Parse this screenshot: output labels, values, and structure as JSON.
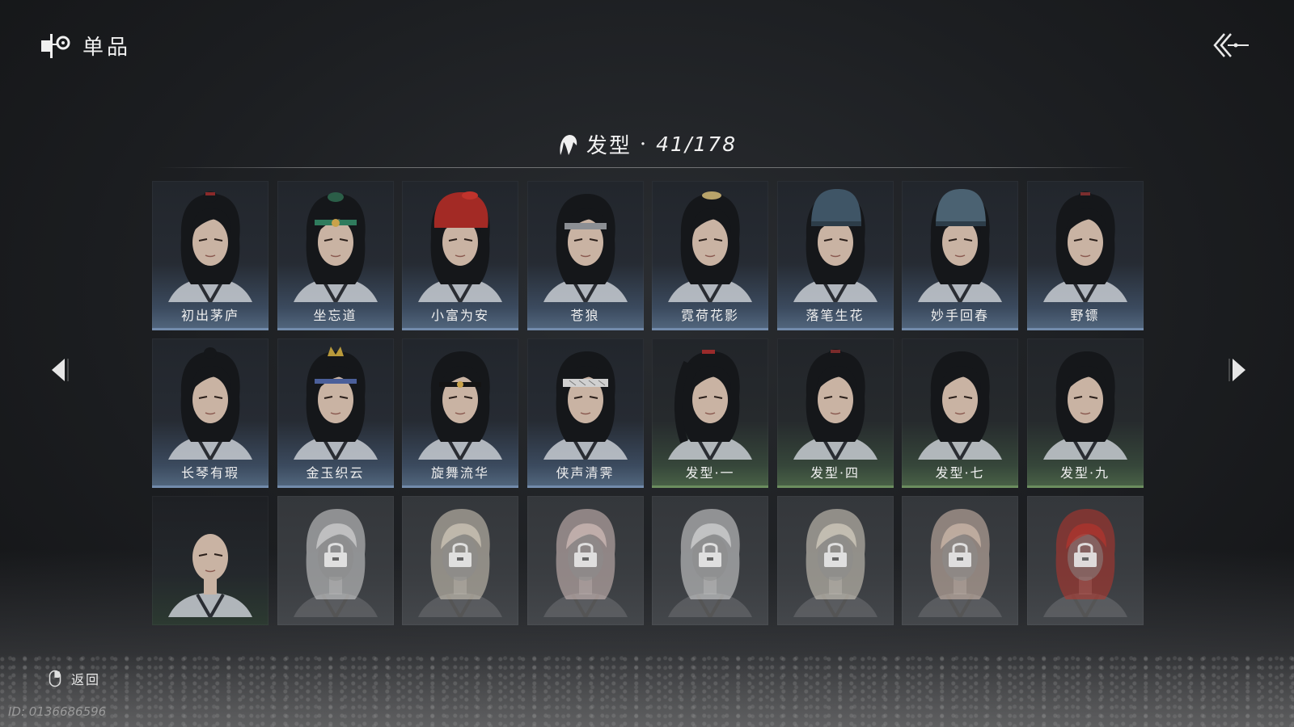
{
  "header": {
    "title": "单品"
  },
  "category": {
    "name": "发型",
    "separator": "·",
    "count": "41/178"
  },
  "row1": [
    {
      "label": "初出茅庐",
      "hat": "topknot-red",
      "accent": "#8a2a2a"
    },
    {
      "label": "坐忘道",
      "hat": "headband-green",
      "accent": "#2f7b5d"
    },
    {
      "label": "小富为安",
      "hat": "bandana-red",
      "accent": "#a32a25"
    },
    {
      "label": "苍狼",
      "hat": "headband-silver",
      "accent": "#8c8f94"
    },
    {
      "label": "霓荷花影",
      "hat": "hairpin-gold",
      "accent": "#b8a36a"
    },
    {
      "label": "落笔生花",
      "hat": "cap-blue",
      "accent": "#3f5566"
    },
    {
      "label": "妙手回春",
      "hat": "cap-blue-round",
      "accent": "#4b6272"
    },
    {
      "label": "野镖",
      "hat": "topknot-red",
      "accent": "#7a2e2e"
    }
  ],
  "row2": [
    {
      "label": "长琴有瑕",
      "hat": "topknot",
      "accent": "#3a3a3a"
    },
    {
      "label": "金玉织云",
      "hat": "crown-gold-headband-blue",
      "accent": "#b99a3b"
    },
    {
      "label": "旋舞流华",
      "hat": "headband-dark-gem",
      "accent": "#5a3f2e"
    },
    {
      "label": "侠声清霁",
      "hat": "headband-white",
      "accent": "#d0d0d0"
    },
    {
      "label": "发型·一",
      "hat": "ponytail-red",
      "accent": "#9a2b2b"
    },
    {
      "label": "发型·四",
      "hat": "bun-red",
      "accent": "#7a2b2b"
    },
    {
      "label": "发型·七",
      "hat": "loose",
      "accent": "#2a2a2a"
    },
    {
      "label": "发型·九",
      "hat": "short",
      "accent": "#2a2a2a"
    }
  ],
  "row3": [
    {
      "state": "unlocked",
      "hair": "bald"
    },
    {
      "state": "locked",
      "hair": "wild-white",
      "color": "#d9d9d9"
    },
    {
      "state": "locked",
      "hair": "long-blonde",
      "color": "#d8d0c0"
    },
    {
      "state": "locked",
      "hair": "long-pink",
      "color": "#d9c3bf"
    },
    {
      "state": "locked",
      "hair": "short-white",
      "color": "#dcdcdc"
    },
    {
      "state": "locked",
      "hair": "spiky-cream",
      "color": "#ddd6c6"
    },
    {
      "state": "locked",
      "hair": "short-peach",
      "color": "#d7c0b0"
    },
    {
      "state": "locked",
      "hair": "long-red",
      "color": "#b8342c"
    }
  ],
  "footer": {
    "back_label": "返回",
    "player_id": "ID: 0136686596"
  },
  "icons": {
    "logo": "game-logo-icon",
    "back_top": "double-chevron-back-icon",
    "category": "hair-icon",
    "mouse": "mouse-icon",
    "lock": "lock-icon",
    "nav_left": "triangle-left-icon",
    "nav_right": "triangle-right-icon"
  }
}
